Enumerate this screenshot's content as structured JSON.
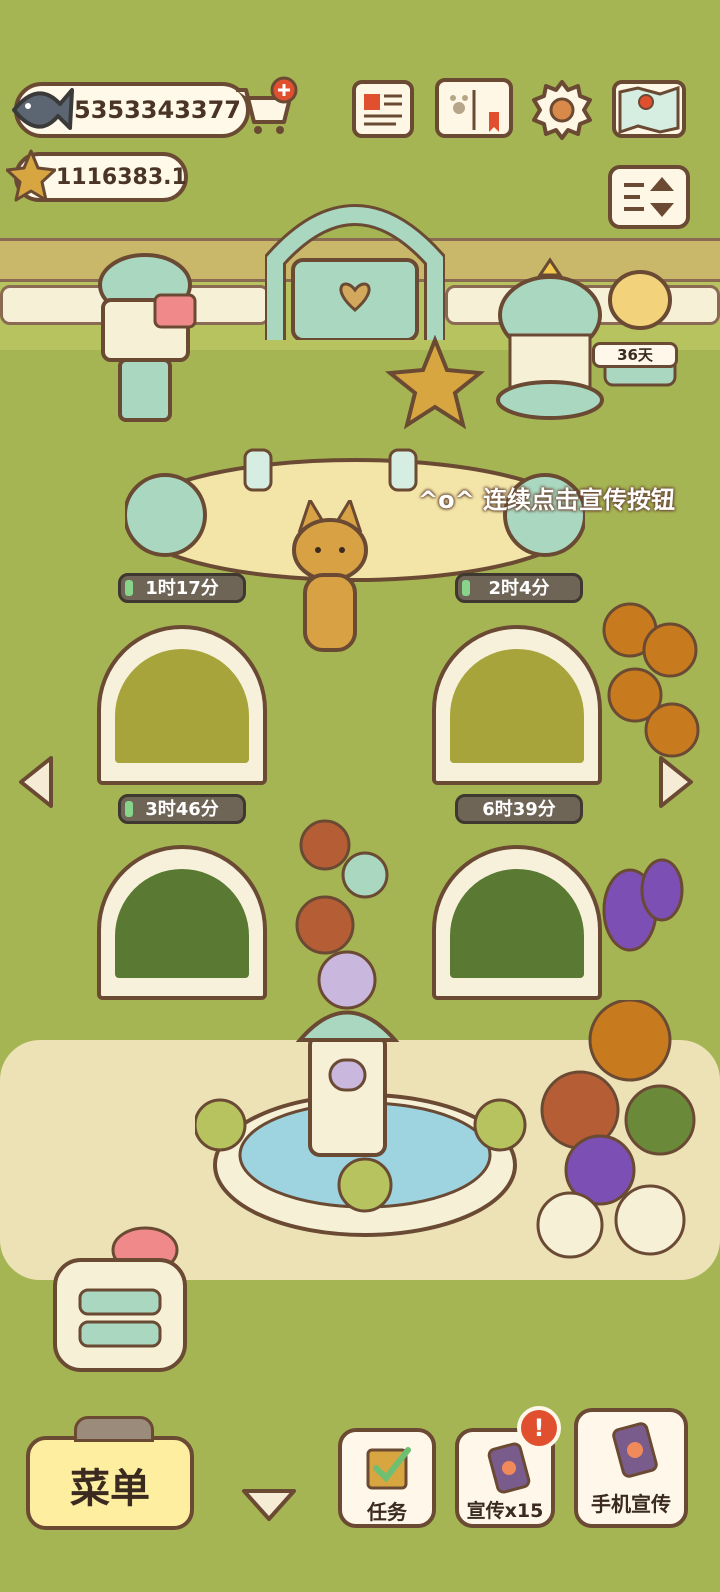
{
  "currency": {
    "fish_amount": "5353343377",
    "star_amount": "1116383.1"
  },
  "timers": {
    "greenhouse_1": "1时17分",
    "greenhouse_2": "2时4分",
    "greenhouse_3": "3时46分",
    "greenhouse_4": "6时39分",
    "event_days": "36天"
  },
  "hint_text": "^o^ 连续点击宣传按钮",
  "bottom_bar": {
    "menu_label": "菜单",
    "task_label": "任务",
    "promo_label": "宣传x15",
    "phone_promo_label": "手机宣传",
    "promo_badge": "!"
  },
  "colors": {
    "grass": "#a6b553",
    "outline": "#6b4a34",
    "menu_button": "#fdeea0",
    "notification_badge": "#e0502f"
  },
  "icons": {
    "fish": "fish-icon",
    "star": "star-icon",
    "cart_plus": "shop-cart-plus-icon",
    "newspaper": "newspaper-icon",
    "catalog_book": "paw-book-icon",
    "settings": "gear-icon",
    "map": "map-icon",
    "sort": "sort-icon",
    "prev": "arrow-left-icon",
    "next": "arrow-right-icon",
    "collapse": "chevron-down-icon"
  }
}
